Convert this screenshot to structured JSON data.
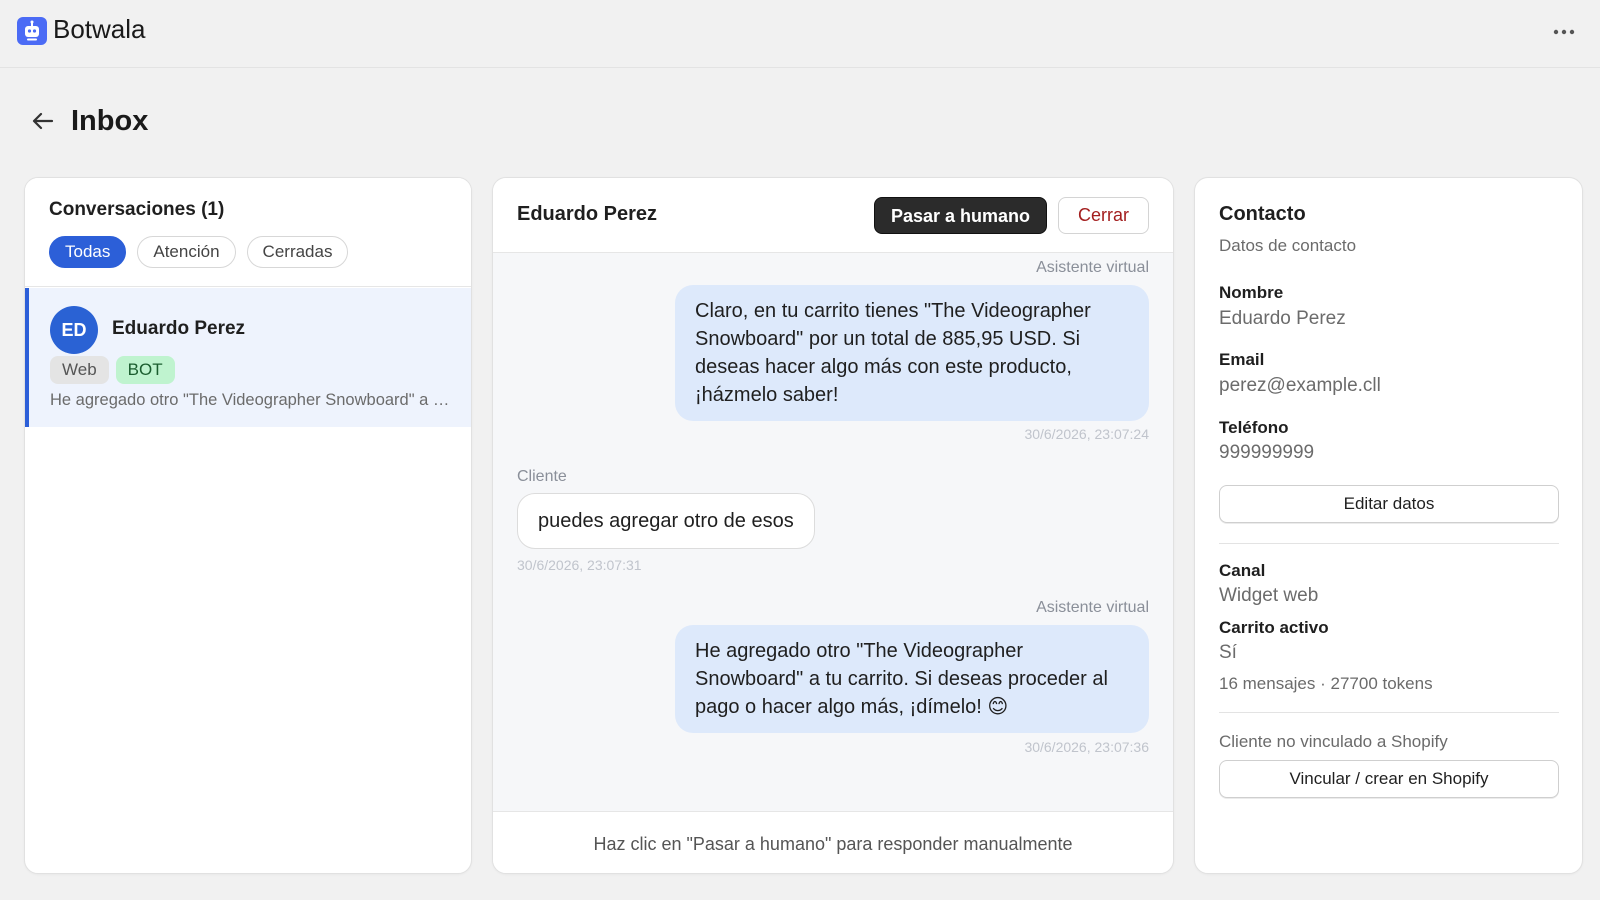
{
  "app": {
    "name": "Botwala",
    "logo_icon": "robot-icon",
    "menu_icon": "more-horizontal-icon"
  },
  "header": {
    "title": "Inbox",
    "back_icon": "arrow-left-icon"
  },
  "conversations": {
    "title": "Conversaciones (1)",
    "filters": [
      "Todas",
      "Atención",
      "Cerradas"
    ],
    "active_filter": "Todas",
    "items": [
      {
        "initials": "ED",
        "name": "Eduardo Perez",
        "tags": [
          "Web",
          "BOT"
        ],
        "preview": "He agregado otro \"The Videographer Snowboard\" a tu carrito. Si deseas proceder al pago o hacer algo más, ¡dímelo! 😊"
      }
    ]
  },
  "chat": {
    "contact_name": "Eduardo Perez",
    "human_button": "Pasar a humano",
    "close_button": "Cerrar",
    "messages": [
      {
        "sender": "Asistente virtual",
        "text": "Claro, en tu carrito tienes \"The Videographer Snowboard\" por un total de 885,95 USD. Si deseas hacer algo más con este producto, ¡házmelo saber!",
        "time": "30/6/2026, 23:07:24"
      },
      {
        "sender": "Cliente",
        "text": "puedes agregar otro de esos",
        "time": "30/6/2026, 23:07:31"
      },
      {
        "sender": "Asistente virtual",
        "text": "He agregado otro \"The Videographer Snowboard\" a tu carrito. Si deseas proceder al pago o hacer algo más, ¡dímelo! 😊",
        "time": "30/6/2026, 23:07:36"
      }
    ],
    "footer_hint": "Haz clic en \"Pasar a humano\" para responder manualmente"
  },
  "contact": {
    "title": "Contacto",
    "subtitle": "Datos de contacto",
    "name_label": "Nombre",
    "name_value": "Eduardo Perez",
    "email_label": "Email",
    "email_value": "perez@example.cll",
    "phone_label": "Teléfono",
    "phone_value": "999999999",
    "edit_button": "Editar datos",
    "channel_label": "Canal",
    "channel_value": "Widget web",
    "cart_label": "Carrito activo",
    "cart_value": "Sí",
    "stats": "16 mensajes · 27700 tokens",
    "shopify_status": "Cliente no vinculado a Shopify",
    "shopify_button": "Vincular / crear en Shopify"
  },
  "colors": {
    "accent": "#2c5fd8",
    "bot_bubble": "#dde9fb",
    "bot_tag": "#bff3cf",
    "danger": "#a31e1e"
  }
}
